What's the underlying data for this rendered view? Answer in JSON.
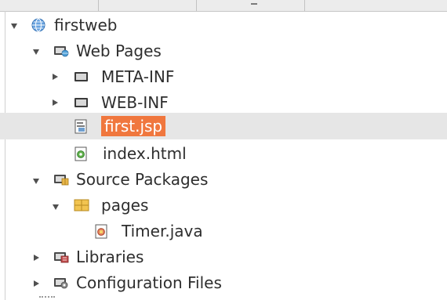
{
  "tree": {
    "nodes": [
      {
        "label": "firstweb",
        "icon": "globe-project-icon",
        "expanded": true
      },
      {
        "label": "Web Pages",
        "icon": "web-pages-folder-icon",
        "expanded": true
      },
      {
        "label": "META-INF",
        "icon": "folder-icon",
        "expanded": false
      },
      {
        "label": "WEB-INF",
        "icon": "folder-icon",
        "expanded": false
      },
      {
        "label": "first.jsp",
        "icon": "jsp-file-icon",
        "selected": true
      },
      {
        "label": "index.html",
        "icon": "html-file-icon"
      },
      {
        "label": "Source Packages",
        "icon": "source-packages-icon",
        "expanded": true
      },
      {
        "label": "pages",
        "icon": "package-icon",
        "expanded": true
      },
      {
        "label": "Timer.java",
        "icon": "java-file-icon"
      },
      {
        "label": "Libraries",
        "icon": "libraries-icon",
        "expanded": false
      },
      {
        "label": "Configuration Files",
        "icon": "configuration-files-icon",
        "expanded": false
      }
    ]
  },
  "colors": {
    "selection_highlight": "#f0773e",
    "selected_row": "#e6e6e6"
  }
}
